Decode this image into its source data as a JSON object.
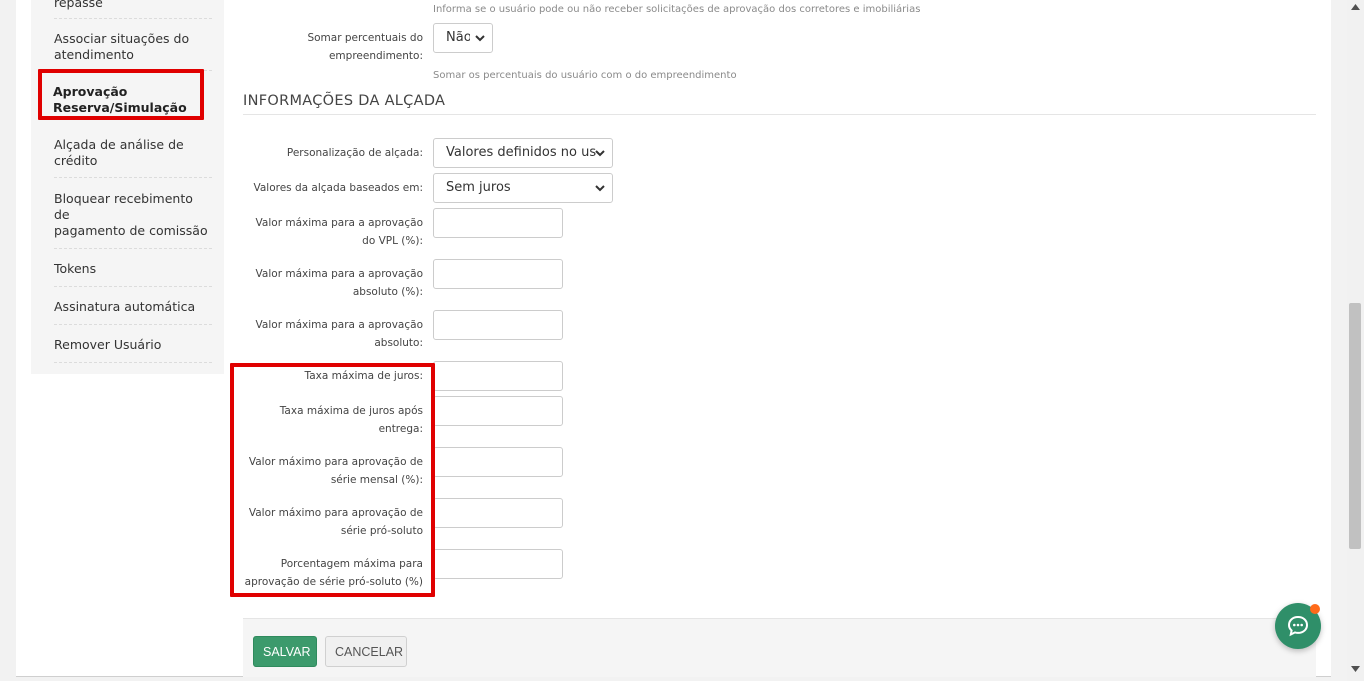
{
  "sidebar": {
    "items": [
      {
        "label": "repasse"
      },
      {
        "label": "Associar situações do atendimento"
      },
      {
        "label": "Aprovação Reserva/Simulação"
      },
      {
        "label": "Alçada de análise de crédito"
      },
      {
        "label": "Bloquear recebimento de\npagamento de comissão"
      },
      {
        "label": "Tokens"
      },
      {
        "label": "Assinatura automática"
      },
      {
        "label": "Remover Usuário"
      }
    ]
  },
  "form_top": {
    "help_approval": "Informa se o usuário pode ou não receber solicitações de aprovação dos corretores e imobiliárias",
    "somar_label": "Somar percentuais do empreendimento:",
    "somar_value": "Não",
    "somar_help": "Somar os percentuais do usuário com o do empreendimento"
  },
  "section": {
    "title": "INFORMAÇÕES DA ALÇADA"
  },
  "fields": {
    "personalizacao_label": "Personalização de alçada:",
    "personalizacao_value": "Valores definidos no us",
    "baseados_label": "Valores da alçada baseados em:",
    "baseados_value": "Sem juros",
    "vpl_label": "Valor máxima para a aprovação do VPL (%):",
    "absoluto_pct_label": "Valor máxima para a aprovação absoluto (%):",
    "absoluto_label": "Valor máxima para a aprovação absoluto:",
    "taxa_label": "Taxa máxima de juros:",
    "taxa_apos_label": "Taxa máxima de juros após entrega:",
    "serie_mensal_label": "Valor máximo para aprovação de série mensal (%):",
    "serie_pro_label": "Valor máximo para aprovação de série pró-soluto",
    "porcentagem_label": "Porcentagem máxima para aprovação de série pró-soluto (%)"
  },
  "buttons": {
    "save": "SALVAR",
    "cancel": "CANCELAR"
  },
  "colors": {
    "accent": "#3c9a6c",
    "highlight": "#e00000",
    "notification": "#ff6a1a"
  }
}
